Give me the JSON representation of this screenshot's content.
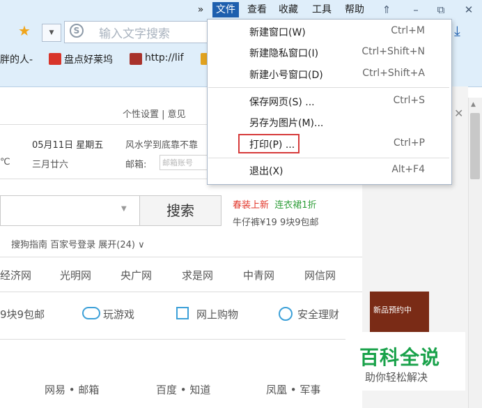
{
  "menubar": {
    "overflow": "»",
    "items": [
      "文件",
      "查看",
      "收藏",
      "工具",
      "帮助"
    ],
    "controls": {
      "skin": "⇑",
      "minimize": "–",
      "restore": "⧉",
      "close": "✕"
    }
  },
  "toolbar": {
    "star": "★",
    "dropdown_arrow": "▼",
    "search_icon_glyph": "S",
    "search_placeholder": "输入文字搜索",
    "download": "⤓"
  },
  "bookmarks": [
    {
      "label": "胖的人-",
      "color": ""
    },
    {
      "label": "盘点好莱坞",
      "color": "#d8342a"
    },
    {
      "label": "http://lif",
      "color": "#a8322b"
    }
  ],
  "page": {
    "top_links": "个性设置 | 意见",
    "date": "05月11日 星期五",
    "temp": "℃",
    "lunar": "三月廿六",
    "news": "风水学到底靠不靠",
    "mail_label": "邮箱:",
    "mail_placeholder": "邮箱账号",
    "search_button": "搜索",
    "promo_red": "春装上新",
    "promo_green": "连衣裙1折",
    "promo_line2": "牛仔裤¥19  9块9包邮",
    "sub_links": "搜狗指南   百家号登录   展开(24) ∨",
    "sites": [
      "经济网",
      "光明网",
      "央广网",
      "求是网",
      "中青网",
      "网信网"
    ],
    "tiles": [
      "9块9包邮",
      "玩游戏",
      "网上购物",
      "安全理财"
    ],
    "bottom_links": [
      "网易 • 邮箱",
      "百度 • 知道",
      "凤凰 • 军事"
    ],
    "ad_badge": "新品预约中"
  },
  "watermark": {
    "title": "百科全说",
    "subtitle": "助你轻松解决"
  },
  "file_menu": {
    "items": [
      {
        "label": "新建窗口(W)",
        "shortcut": "Ctrl+M"
      },
      {
        "label": "新建隐私窗口(I)",
        "shortcut": "Ctrl+Shift+N"
      },
      {
        "label": "新建小号窗口(D)",
        "shortcut": "Ctrl+Shift+A"
      },
      {
        "label": "保存网页(S) ...",
        "shortcut": "Ctrl+S"
      },
      {
        "label": "另存为图片(M)...",
        "shortcut": ""
      },
      {
        "label": "打印(P) ...",
        "shortcut": "Ctrl+P"
      },
      {
        "label": "退出(X)",
        "shortcut": "Alt+F4"
      }
    ]
  },
  "colors": {
    "accent": "#1e5fae",
    "highlight": "#d63a3a",
    "watermark": "#19a24a",
    "promo_red": "#e2372b",
    "promo_green": "#2f9e3a"
  }
}
